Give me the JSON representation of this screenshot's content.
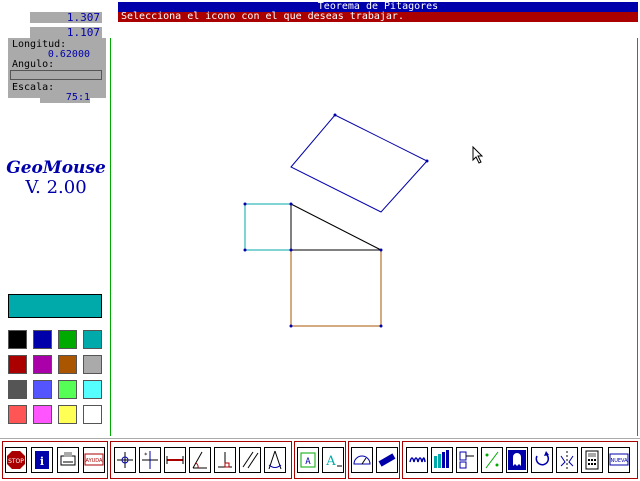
{
  "readouts": {
    "x": "1.307",
    "y": "1.107"
  },
  "window": {
    "title": "Teorema de Pitagores",
    "status": "Selecciona el icono con el que deseas trabajar."
  },
  "panel": {
    "longitud_label": "Longitud:",
    "longitud_value": "0.62000",
    "angulo_label": "Angulo:",
    "escala_label": "Escala:",
    "escala_value": "75:1"
  },
  "logo": {
    "name": "GeoMouse",
    "version": "V. 2.00"
  },
  "colors": {
    "current": "#00aaaa",
    "palette": [
      "#000000",
      "#0000aa",
      "#00aa00",
      "#00aaaa",
      "#aa0000",
      "#aa00aa",
      "#aa5500",
      "#aaaaaa",
      "#555555",
      "#5555ff",
      "#55ff55",
      "#55ffff",
      "#ff5555",
      "#ff55ff",
      "#ffff55",
      "#ffffff"
    ]
  },
  "toolbar": {
    "stop_label": "STOP",
    "ayuda_label": "AYUDA",
    "nueva_label": "NUEVA",
    "icons": [
      "stop-icon",
      "info-icon",
      "print-icon",
      "help-icon",
      "point-icon",
      "intersection-icon",
      "segment-icon",
      "angle-icon",
      "perpendicular-icon",
      "parallel-icon",
      "compass-icon",
      "label-icon",
      "text-icon",
      "protractor-icon",
      "ruler-icon",
      "spring-icon",
      "stairs-icon",
      "arrow-icon",
      "ratio-icon",
      "ghost-icon",
      "rotate-icon",
      "symmetry-icon",
      "calculator-icon",
      "new-icon"
    ]
  }
}
